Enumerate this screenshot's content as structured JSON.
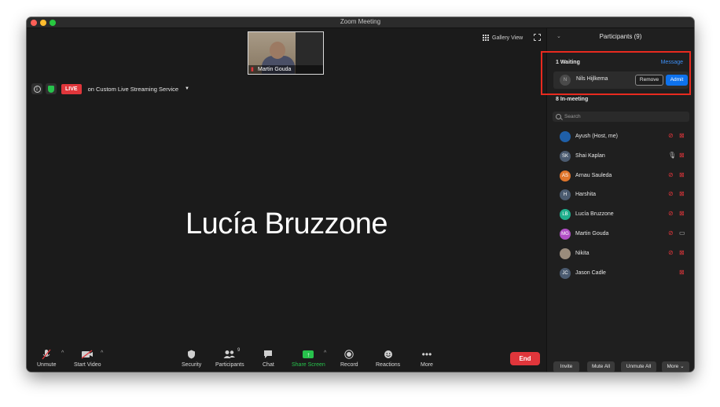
{
  "window": {
    "title": "Zoom Meeting"
  },
  "main": {
    "thumbnail": {
      "name": "Martin Gouda"
    },
    "gallery_view_label": "Gallery View",
    "live_badge": "LIVE",
    "streaming_label": "on Custom Live Streaming Service",
    "active_speaker": "Lucía Bruzzone"
  },
  "toolbar": {
    "unmute": "Unmute",
    "start_video": "Start Video",
    "security": "Security",
    "participants": "Participants",
    "participants_count": "9",
    "chat": "Chat",
    "share_screen": "Share Screen",
    "record": "Record",
    "reactions": "Reactions",
    "more": "More",
    "end": "End"
  },
  "panel": {
    "title": "Participants (9)",
    "waiting_title": "1 Waiting",
    "message_link": "Message",
    "waiting": {
      "initial": "N",
      "name": "Nils Hijlkema",
      "remove": "Remove",
      "admit": "Admit"
    },
    "inmeeting_title": "8 In-meeting",
    "search_placeholder": "Search",
    "participants": [
      {
        "initials": "",
        "name": "Ayush (Host, me)",
        "avatar_color": "#1f5fa8",
        "mic": "muted",
        "video": "off"
      },
      {
        "initials": "SK",
        "name": "Shai Kaplan",
        "avatar_color": "#4b5b70",
        "mic": "on",
        "video": "off"
      },
      {
        "initials": "AS",
        "name": "Arnau Sauleda",
        "avatar_color": "#e0752b",
        "mic": "muted",
        "video": "off"
      },
      {
        "initials": "H",
        "name": "Harshita",
        "avatar_color": "#4b5b70",
        "mic": "muted",
        "video": "off"
      },
      {
        "initials": "LB",
        "name": "Lucía Bruzzone",
        "avatar_color": "#1fae8c",
        "mic": "muted",
        "video": "off"
      },
      {
        "initials": "MG",
        "name": "Martin Gouda",
        "avatar_color": "#b14fc5",
        "mic": "muted",
        "video": "on"
      },
      {
        "initials": "",
        "name": "Nikita",
        "avatar_color": "#9a8c7c",
        "mic": "muted",
        "video": "off"
      },
      {
        "initials": "JC",
        "name": "Jason Cadle",
        "avatar_color": "#4b5b70",
        "mic": "none",
        "video": "off"
      }
    ],
    "footer": {
      "invite": "Invite",
      "mute_all": "Mute All",
      "unmute_all": "Unmute All",
      "more": "More"
    }
  }
}
